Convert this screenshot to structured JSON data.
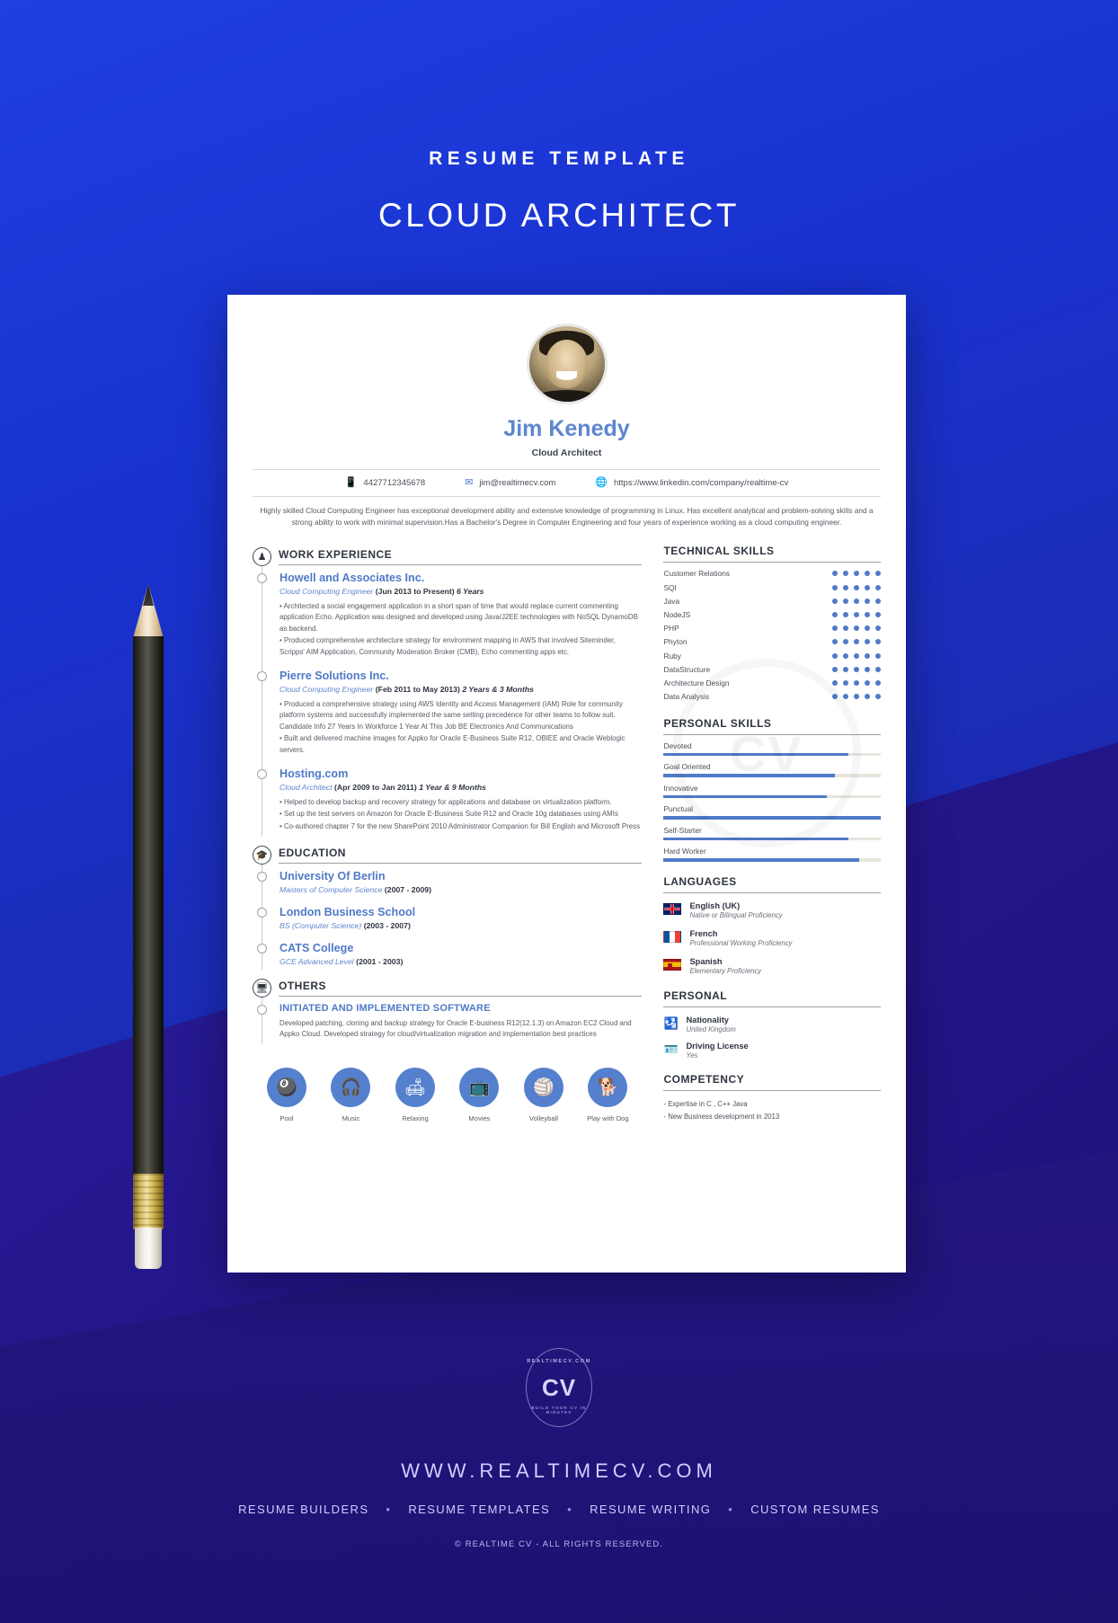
{
  "header": {
    "eyebrow": "RESUME TEMPLATE",
    "title": "CLOUD ARCHITECT"
  },
  "resume": {
    "name": "Jim Kenedy",
    "role": "Cloud Architect",
    "contacts": [
      {
        "icon": "phone-icon",
        "glyph": "📱",
        "value": "4427712345678"
      },
      {
        "icon": "email-icon",
        "glyph": "✉",
        "value": "jim@realtimecv.com"
      },
      {
        "icon": "globe-icon",
        "glyph": "🌐",
        "value": "https://www.linkedin.com/company/realtime-cv"
      }
    ],
    "summary": "Highly skilled Cloud Computing Engineer has exceptional development ability and extensive knowledge of programming in Linux. Has excellent analytical and problem-solving skills and a strong ability to work with minimal supervision.Has a Bachelor's Degree in Computer Engineering and four years of experience working as a cloud computing engineer.",
    "work": {
      "section_title": "WORK EXPERIENCE",
      "section_icon": "people-icon",
      "items": [
        {
          "company": "Howell and Associates Inc.",
          "position": "Cloud Computing Engineer",
          "dates": "(Jun 2013 to Present)",
          "duration": "6 Years",
          "bullets": [
            "• Architected a social engagement application in a short span of time that would replace current commenting application Echo. Application was designed and developed using Java/J2EE technologies with NoSQL DynamoDB as backend.",
            "• Produced comprehensive architecture strategy for environment mapping in AWS that involved Siteminder, Scripps' AIM Application, Community Moderation Broker (CMB), Echo commenting apps etc."
          ]
        },
        {
          "company": "Pierre Solutions Inc.",
          "position": "Cloud Computing Engineer",
          "dates": "(Feb 2011 to May 2013)",
          "duration": "2 Years & 3 Months",
          "bullets": [
            "• Produced a comprehensive strategy using AWS Identity and Access Management (IAM) Role for community platform systems and successfully implemented the same setting precedence for other teams to follow suit. Candidate Info 27 Years In Workforce 1 Year At This Job BE Electronics And Communications",
            "• Built and delivered machine images for Appko for Oracle E-Business Suite R12, OBIEE and Oracle Weblogic servers."
          ]
        },
        {
          "company": "Hosting.com",
          "position": "Cloud Architect",
          "dates": "(Apr 2009 to Jan 2011)",
          "duration": "1 Year & 9 Months",
          "bullets": [
            "• Helped to develop backup and recovery strategy for applications and database on virtualization platform.",
            "• Set up the test servers on Amazon for Oracle E-Business Suite R12 and Oracle 10g databases using AMIs",
            "• Co-authored chapter 7 for the new SharePoint 2010 Administrator Companion for Bill English and Microsoft Press"
          ]
        }
      ]
    },
    "education": {
      "section_title": "EDUCATION",
      "section_icon": "graduation-cap-icon",
      "items": [
        {
          "school": "University Of Berlin",
          "degree": "Masters of Computer Science",
          "years": "(2007 - 2009)"
        },
        {
          "school": "London Business School",
          "degree": "BS (Computer Science)",
          "years": "(2003 - 2007)"
        },
        {
          "school": "CATS College",
          "degree": "GCE Advanced Level",
          "years": "(2001 - 2003)"
        }
      ]
    },
    "others": {
      "section_title": "OTHERS",
      "section_icon": "monitor-icon",
      "items": [
        {
          "title": "INITIATED AND IMPLEMENTED SOFTWARE",
          "body": "Developed patching, cloning and backup strategy for Oracle E-business R12(12.1.3) on Amazon EC2 Cloud and Appko Cloud. Developed strategy for cloud/virtualization migration and implementation best practices"
        }
      ]
    },
    "hobbies": [
      {
        "label": "Pool",
        "icon": "pool-table-icon",
        "glyph": "🎱"
      },
      {
        "label": "Music",
        "icon": "headphones-icon",
        "glyph": "🎧"
      },
      {
        "label": "Relaxing",
        "icon": "hammock-icon",
        "glyph": "🛋"
      },
      {
        "label": "Movies",
        "icon": "tv-icon",
        "glyph": "📺"
      },
      {
        "label": "Volleyball",
        "icon": "volleyball-icon",
        "glyph": "🏐"
      },
      {
        "label": "Play with Dog",
        "icon": "dog-icon",
        "glyph": "🐕"
      }
    ],
    "technical_skills": {
      "title": "TECHNICAL SKILLS",
      "max": 5,
      "items": [
        {
          "name": "Customer Relations",
          "level": 5
        },
        {
          "name": "SQl",
          "level": 5
        },
        {
          "name": "Java",
          "level": 5
        },
        {
          "name": "NodeJS",
          "level": 5
        },
        {
          "name": "PHP",
          "level": 5
        },
        {
          "name": "Phyton",
          "level": 5
        },
        {
          "name": "Ruby",
          "level": 5
        },
        {
          "name": "DataStructure",
          "level": 5
        },
        {
          "name": "Architecture Design",
          "level": 5
        },
        {
          "name": "Data Analysis",
          "level": 5
        }
      ]
    },
    "personal_skills": {
      "title": "PERSONAL SKILLS",
      "items": [
        {
          "name": "Devoted",
          "percent": 85
        },
        {
          "name": "Goal Oriented",
          "percent": 79
        },
        {
          "name": "Innovative",
          "percent": 75
        },
        {
          "name": "Punctual",
          "percent": 100
        },
        {
          "name": "Self-Starter",
          "percent": 85
        },
        {
          "name": "Hard Worker",
          "percent": 90
        }
      ]
    },
    "languages": {
      "title": "LANGUAGES",
      "items": [
        {
          "name": "English (UK)",
          "proficiency": "Native or Bilingual Proficiency",
          "flag": "flag-uk"
        },
        {
          "name": "French",
          "proficiency": "Professional Working Proficiency",
          "flag": "flag-fr"
        },
        {
          "name": "Spanish",
          "proficiency": "Elementary Proficiency",
          "flag": "flag-es"
        }
      ]
    },
    "personal": {
      "title": "PERSONAL",
      "items": [
        {
          "label": "Nationality",
          "value": "United Kingdom",
          "icon": "passport-icon",
          "glyph": "🛂"
        },
        {
          "label": "Driving License",
          "value": "Yes",
          "icon": "id-card-icon",
          "glyph": "🪪"
        }
      ]
    },
    "competency": {
      "title": "COMPETENCY",
      "items": [
        "- Expertise in C , C++ Java",
        "- New Business development in 2013"
      ]
    },
    "watermark": "CV"
  },
  "footer": {
    "badge": {
      "text": "CV",
      "top_arc": "REALTIMECV.COM",
      "bottom_arc": "BUILD YOUR CV IN MINUTES"
    },
    "url": "WWW.REALTIMECV.COM",
    "links": [
      "RESUME BUILDERS",
      "RESUME TEMPLATES",
      "RESUME WRITING",
      "CUSTOM RESUMES"
    ],
    "separator": "•",
    "copyright": "©  REALTIME CV - ALL RIGHTS RESERVED."
  },
  "colors": {
    "accent": "#4f7ac8",
    "brand_blue": "#1d2fb4",
    "name_blue": "#5d86d1"
  }
}
